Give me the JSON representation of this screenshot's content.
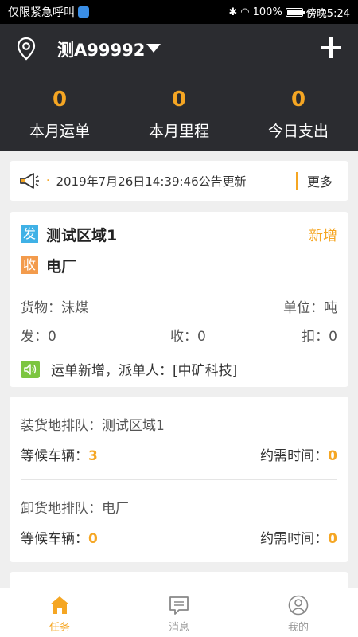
{
  "status_bar": {
    "carrier": "仅限紧急呼叫",
    "battery": "100%",
    "time": "傍晚5:24"
  },
  "header": {
    "plate": "测A99992",
    "stats": [
      {
        "value": "0",
        "label": "本月运单"
      },
      {
        "value": "0",
        "label": "本月里程"
      },
      {
        "value": "0",
        "label": "今日支出"
      }
    ]
  },
  "notice": {
    "dot": "·",
    "text": "2019年7月26日14:39:46公告更新",
    "more": "更多"
  },
  "order": {
    "send_tag": "发",
    "from": "测试区域1",
    "recv_tag": "收",
    "to": "电厂",
    "status": "新增",
    "cargo": "货物：沫煤",
    "unit": "单位：吨",
    "sent": "发：0",
    "received": "收：0",
    "deducted": "扣：0",
    "dispatch": "运单新增，派单人：[中矿科技]"
  },
  "queue": {
    "load_title": "装货地排队：测试区域1",
    "load_wait_label": "等候车辆：",
    "load_wait_count": "3",
    "load_time_label": "约需时间：",
    "load_time_value": "0",
    "unload_title": "卸货地排队：电厂",
    "unload_wait_label": "等候车辆：",
    "unload_wait_count": "0",
    "unload_time_label": "约需时间：",
    "unload_time_value": "0"
  },
  "tabs": [
    {
      "label": "任务",
      "icon": "home-icon",
      "active": true
    },
    {
      "label": "消息",
      "icon": "message-icon",
      "active": false
    },
    {
      "label": "我的",
      "icon": "user-icon",
      "active": false
    }
  ],
  "colors": {
    "accent": "#f5a623",
    "header_bg": "#2b2c30",
    "send_tag": "#3fb1e6",
    "recv_tag": "#f39b4c",
    "speaker": "#7cc540"
  }
}
